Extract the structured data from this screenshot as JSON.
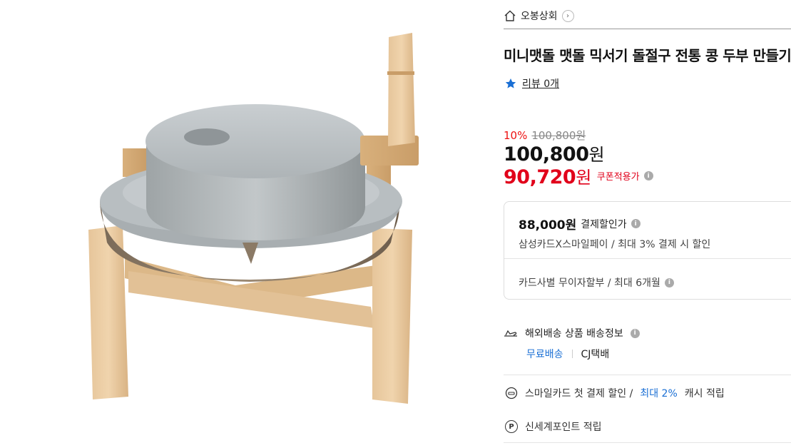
{
  "store": {
    "name": "오봉상회",
    "home_icon": "home-icon",
    "chevron": "›"
  },
  "product": {
    "title": "미니맷돌 맷돌 믹서기 돌절구 전통 콩 두부 만들기",
    "review_label": "리뷰 0개",
    "discount_rate": "10%",
    "original_price": "100,800원",
    "price_number": "100,800",
    "coupon_price_number": "90,720",
    "won": "원",
    "coupon_label": "쿠폰적용가"
  },
  "card_benefit": {
    "price": "88,000원",
    "label": "결제할인가",
    "description": "삼성카드X스마일페이 / 최대 3% 결제 시 할인",
    "installment": "카드사별 무이자할부 / 최대 6개월"
  },
  "shipping": {
    "title": "해외배송 상품 배송정보",
    "free": "무료배송",
    "carrier": "CJ택배"
  },
  "smile_card": {
    "prefix": "스마일카드 첫 결제 할인 /",
    "highlight": "최대 2%",
    "suffix": "캐시 적립"
  },
  "points": {
    "icon_letter": "P",
    "label": "신세계포인트 적립"
  },
  "info_glyph": "i",
  "colors": {
    "accent_red": "#e1001a",
    "link_blue": "#1a6fd4",
    "star_blue": "#1a6fd4"
  }
}
